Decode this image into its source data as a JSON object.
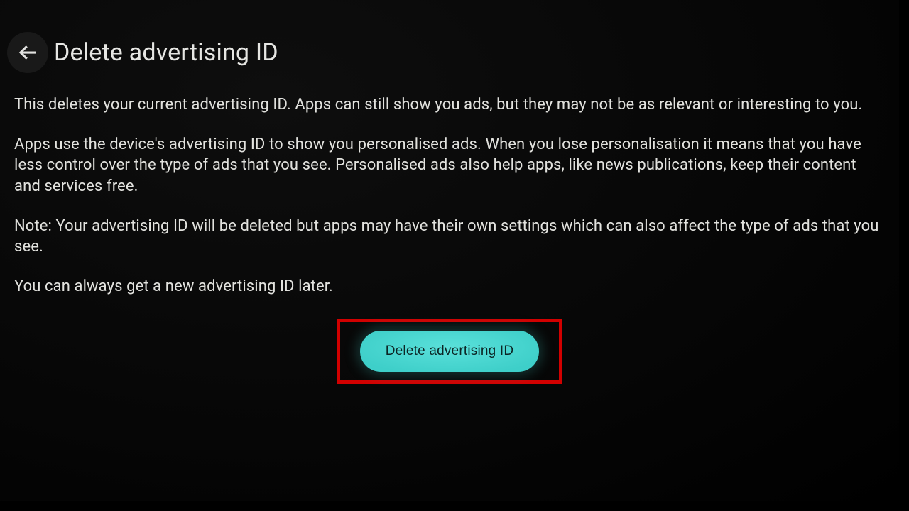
{
  "header": {
    "title": "Delete advertising ID"
  },
  "body": {
    "para1": "This deletes your current advertising ID. Apps can still show you ads, but they may not be as relevant or interesting to you.",
    "para2": "Apps use the device's advertising ID to show you personalised ads. When you lose personalisation it means that you have less control over the type of ads that you see. Personalised ads also help apps, like news publications, keep their content and services free.",
    "para3": "Note: Your advertising ID will be deleted but apps may have their own settings which can also affect the type of ads that you see.",
    "para4": "You can always get a new advertising ID later."
  },
  "actions": {
    "delete_label": "Delete advertising ID"
  }
}
